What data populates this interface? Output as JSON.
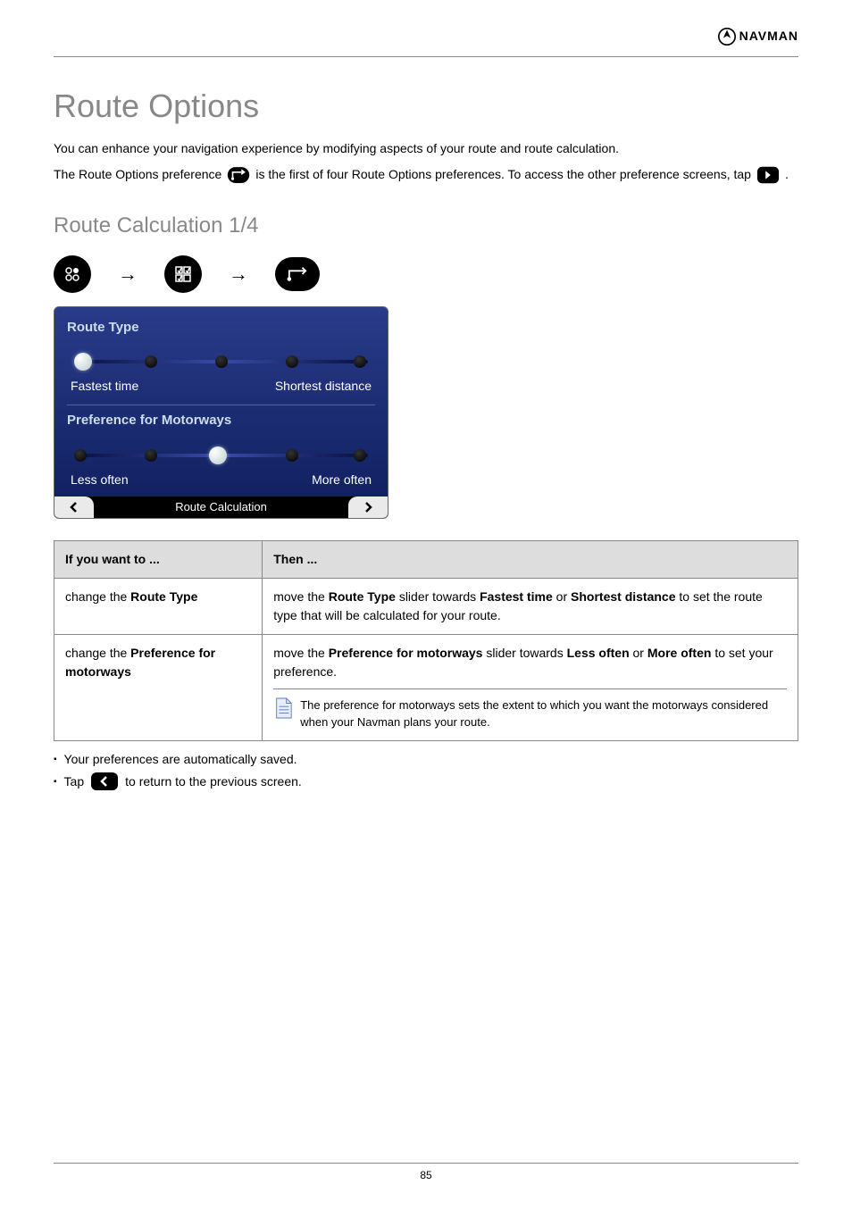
{
  "header": {
    "brand": "NAVMAN"
  },
  "section_title": "Route Options",
  "intro": "You can enhance your navigation experience by modifying aspects of your route and route calculation.",
  "note_prefix": "The Route Options preference",
  "note_mid": " is the first of four Route Options preferences. To access the other preference screens, tap ",
  "note_suffix": ".",
  "subsection_title": "Route Calculation 1/4",
  "device": {
    "group1_title": "Route Type",
    "group1_left": "Fastest time",
    "group1_right": "Shortest distance",
    "group2_title": "Preference for Motorways",
    "group2_left": "Less often",
    "group2_right": "More often",
    "footer_label": "Route Calculation"
  },
  "table": {
    "col1_header": "If you want to ...",
    "col2_header": "Then ...",
    "rows": [
      {
        "want_label": "change the ",
        "want_bold": "Route Type",
        "then_lead": "move the ",
        "then_bold1": "Route Type",
        "then_mid": " slider towards ",
        "then_bold2": "Fastest time",
        "then_or": " or ",
        "then_bold3": "Shortest distance",
        "then_tail": " to set the route type that will be calculated for your route."
      },
      {
        "want_label": "change the ",
        "want_bold": "Preference for motorways",
        "then_lead": "move the ",
        "then_bold1": "Preference for motorways",
        "then_mid": " slider towards ",
        "then_bold2": "Less often",
        "then_or": " or ",
        "then_bold3": "More often",
        "then_tail": " to set your preference.",
        "note": "The preference for motorways sets the extent to which you want the motorways considered when your Navman plans your route."
      }
    ]
  },
  "bullets": {
    "save": "Your preferences are automatically saved.",
    "back": "Tap ",
    "back_tail": " to return to the previous screen."
  },
  "page_number": "85"
}
